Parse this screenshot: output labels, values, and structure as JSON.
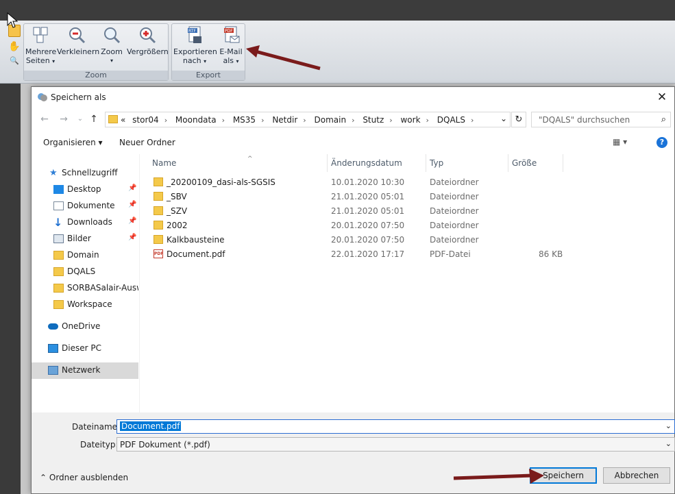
{
  "ribbon": {
    "zoom_group": {
      "label": "Zoom",
      "buttons": [
        {
          "label": "Mehrere",
          "label2": "Seiten"
        },
        {
          "label": "Verkleinern",
          "label2": ""
        },
        {
          "label": "Zoom",
          "label2": ""
        },
        {
          "label": "Vergrößern",
          "label2": ""
        }
      ]
    },
    "export_group": {
      "label": "Export",
      "buttons": [
        {
          "label": "Exportieren",
          "label2": "nach",
          "icon_text": "RTF"
        },
        {
          "label": "E-Mail",
          "label2": "als",
          "icon_text": "PDF"
        }
      ]
    },
    "caret": "▾"
  },
  "dialog": {
    "title": "Speichern als",
    "close": "✕",
    "nav": {
      "back": "←",
      "forward": "→",
      "history": "⌄",
      "up": "↑"
    },
    "address": {
      "overflow": "«",
      "crumbs": [
        "stor04",
        "Moondata",
        "MS35",
        "Netdir",
        "Domain",
        "Stutz",
        "work",
        "DQALS"
      ],
      "separator": "›",
      "dropdown": "⌄",
      "refresh": "↻"
    },
    "search": {
      "placeholder": "\"DQALS\" durchsuchen",
      "icon": "⌕"
    },
    "toolbar": {
      "organize": "Organisieren ▾",
      "new_folder": "Neuer Ordner",
      "view": "▦ ▾",
      "help": "?"
    },
    "nav_pane": [
      {
        "label": "Schnellzugriff",
        "icon": "star-icon",
        "pinned": false
      },
      {
        "label": "Desktop",
        "icon": "desktop-icon",
        "pinned": true
      },
      {
        "label": "Dokumente",
        "icon": "documents-icon",
        "pinned": true
      },
      {
        "label": "Downloads",
        "icon": "download-icon",
        "pinned": true
      },
      {
        "label": "Bilder",
        "icon": "pictures-icon",
        "pinned": true
      },
      {
        "label": "Domain",
        "icon": "folder-icon",
        "pinned": false
      },
      {
        "label": "DQALS",
        "icon": "folder-icon",
        "pinned": false
      },
      {
        "label": "SORBASalair-Auswe",
        "icon": "folder-icon",
        "pinned": false
      },
      {
        "label": "Workspace",
        "icon": "folder-icon",
        "pinned": false
      },
      {
        "label": "OneDrive",
        "icon": "cloud-icon",
        "pinned": false
      },
      {
        "label": "Dieser PC",
        "icon": "pc-icon",
        "pinned": false
      },
      {
        "label": "Netzwerk",
        "icon": "network-icon",
        "pinned": false,
        "selected": true
      }
    ],
    "pin_glyph": "📌",
    "columns": {
      "name": "Name",
      "date": "Änderungsdatum",
      "type": "Typ",
      "size": "Größe",
      "sort_caret": "^"
    },
    "files": [
      {
        "name": "_20200109_dasi-als-SGSIS",
        "date": "10.01.2020 10:30",
        "type": "Dateiordner",
        "size": "",
        "kind": "folder"
      },
      {
        "name": "_SBV",
        "date": "21.01.2020 05:01",
        "type": "Dateiordner",
        "size": "",
        "kind": "folder"
      },
      {
        "name": "_SZV",
        "date": "21.01.2020 05:01",
        "type": "Dateiordner",
        "size": "",
        "kind": "folder"
      },
      {
        "name": "2002",
        "date": "20.01.2020 07:50",
        "type": "Dateiordner",
        "size": "",
        "kind": "folder"
      },
      {
        "name": "Kalkbausteine",
        "date": "20.01.2020 07:50",
        "type": "Dateiordner",
        "size": "",
        "kind": "folder"
      },
      {
        "name": "Document.pdf",
        "date": "22.01.2020 17:17",
        "type": "PDF-Datei",
        "size": "86 KB",
        "kind": "pdf"
      }
    ],
    "pdf_icon_text": "PDF",
    "bottom": {
      "filename_label": "Dateiname:",
      "filename_value": "Document.pdf",
      "filetype_label": "Dateityp:",
      "filetype_value": "PDF Dokument (*.pdf)",
      "dropdown": "⌄",
      "hide_folders": "⌃  Ordner ausblenden",
      "save": "Speichern",
      "cancel": "Abbrechen"
    }
  }
}
